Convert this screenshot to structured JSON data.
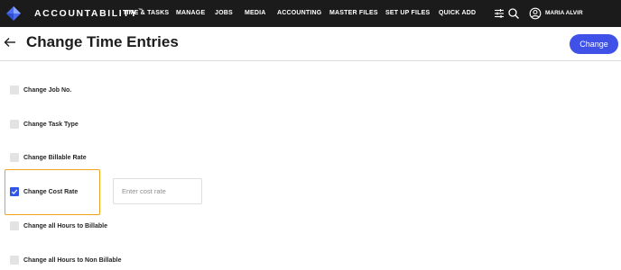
{
  "app": {
    "brand": "ACCOUNTABILITY",
    "trademark": "™",
    "nav": [
      {
        "label": "TIME & TASKS"
      },
      {
        "label": "MANAGE"
      },
      {
        "label": "JOBS"
      },
      {
        "label": "MEDIA"
      },
      {
        "label": "ACCOUNTING"
      },
      {
        "label": "MASTER FILES"
      },
      {
        "label": "SET UP FILES"
      },
      {
        "label": "QUICK ADD"
      }
    ],
    "icons": {
      "filter": "sliders-icon",
      "search": "search-icon",
      "user": "user-circle-icon"
    },
    "user": {
      "name": "MARIA ALVIR"
    }
  },
  "header": {
    "title": "Change Time Entries",
    "back_icon": "arrow-left-icon",
    "action_label": "Change"
  },
  "options": [
    {
      "label": "Change Job No.",
      "checked": false
    },
    {
      "label": "Change Task Type",
      "checked": false
    },
    {
      "label": "Change Billable Rate",
      "checked": false
    },
    {
      "label": "Change Cost Rate",
      "checked": true
    },
    {
      "label": "Change all Hours to Billable",
      "checked": false
    },
    {
      "label": "Change all Hours to Non Billable",
      "checked": false
    }
  ],
  "cost_rate": {
    "placeholder": "Enter cost rate",
    "value": ""
  },
  "colors": {
    "topbar": "#1b1b1b",
    "accent": "#3f51e6",
    "checkbox_checked": "#2f56e8",
    "highlight": "#f0a21c"
  }
}
